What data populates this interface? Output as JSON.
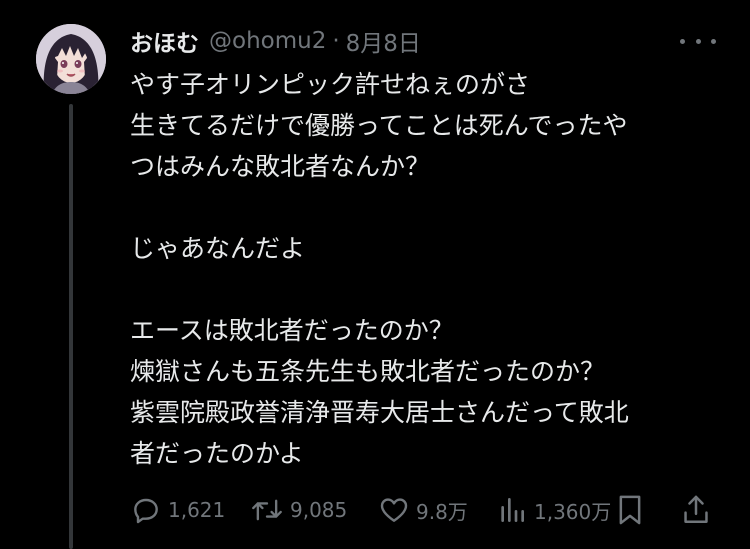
{
  "user": {
    "display_name": "おほむ",
    "handle": "@ohomu2",
    "separator": "·",
    "date": "8月8日",
    "avatar_icon": "anime-girl-avatar-icon"
  },
  "tweet": {
    "lines": [
      "やす子オリンピック許せねぇのがさ",
      "生きてるだけで優勝ってことは死んでったや",
      "つはみんな敗北者なんか？",
      "",
      "じゃあなんだよ",
      "",
      "エースは敗北者だったのか？",
      "煉獄さんも五条先生も敗北者だったのか？",
      "紫雲院殿政誉清浄晋寿大居士さんだって敗北",
      "者だったのかよ"
    ]
  },
  "actions": {
    "replies": "1,621",
    "retweets": "9,085",
    "likes": "9.8万",
    "views": "1,360万",
    "icons": {
      "more": "more-dots-icon",
      "reply": "reply-icon",
      "retweet": "retweet-icon",
      "like": "heart-icon",
      "views": "views-bar-icon",
      "bookmark": "bookmark-icon",
      "share": "share-icon"
    }
  },
  "colors": {
    "background": "#000000",
    "text": "#e7e9ea",
    "muted": "#71767b",
    "thread_line": "#333639"
  }
}
